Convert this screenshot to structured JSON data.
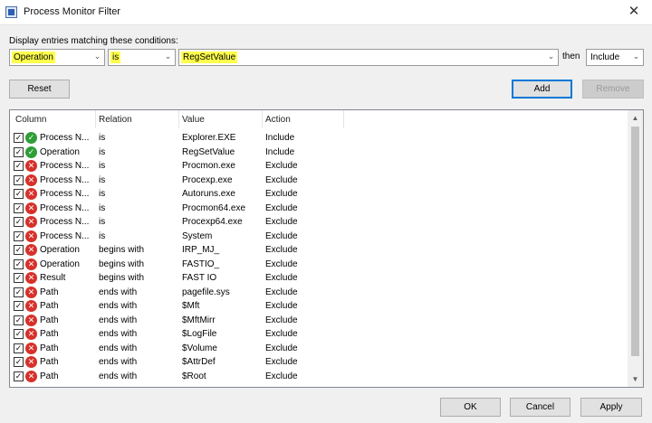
{
  "window": {
    "title": "Process Monitor Filter",
    "close_glyph": "✕"
  },
  "conditions": {
    "label": "Display entries matching these conditions:",
    "column_value": "Operation",
    "relation_value": "is",
    "value_value": "RegSetValue",
    "then_label": "then",
    "action_value": "Include"
  },
  "buttons": {
    "reset": "Reset",
    "add": "Add",
    "remove": "Remove",
    "ok": "OK",
    "cancel": "Cancel",
    "apply": "Apply"
  },
  "list": {
    "headers": {
      "column": "Column",
      "relation": "Relation",
      "value": "Value",
      "action": "Action"
    },
    "rows": [
      {
        "column": "Process N...",
        "relation": "is",
        "value": "Explorer.EXE",
        "action": "Include",
        "status": "include"
      },
      {
        "column": "Operation",
        "relation": "is",
        "value": "RegSetValue",
        "action": "Include",
        "status": "include"
      },
      {
        "column": "Process N...",
        "relation": "is",
        "value": "Procmon.exe",
        "action": "Exclude",
        "status": "exclude"
      },
      {
        "column": "Process N...",
        "relation": "is",
        "value": "Procexp.exe",
        "action": "Exclude",
        "status": "exclude"
      },
      {
        "column": "Process N...",
        "relation": "is",
        "value": "Autoruns.exe",
        "action": "Exclude",
        "status": "exclude"
      },
      {
        "column": "Process N...",
        "relation": "is",
        "value": "Procmon64.exe",
        "action": "Exclude",
        "status": "exclude"
      },
      {
        "column": "Process N...",
        "relation": "is",
        "value": "Procexp64.exe",
        "action": "Exclude",
        "status": "exclude"
      },
      {
        "column": "Process N...",
        "relation": "is",
        "value": "System",
        "action": "Exclude",
        "status": "exclude"
      },
      {
        "column": "Operation",
        "relation": "begins with",
        "value": "IRP_MJ_",
        "action": "Exclude",
        "status": "exclude"
      },
      {
        "column": "Operation",
        "relation": "begins with",
        "value": "FASTIO_",
        "action": "Exclude",
        "status": "exclude"
      },
      {
        "column": "Result",
        "relation": "begins with",
        "value": "FAST IO",
        "action": "Exclude",
        "status": "exclude"
      },
      {
        "column": "Path",
        "relation": "ends with",
        "value": "pagefile.sys",
        "action": "Exclude",
        "status": "exclude"
      },
      {
        "column": "Path",
        "relation": "ends with",
        "value": "$Mft",
        "action": "Exclude",
        "status": "exclude"
      },
      {
        "column": "Path",
        "relation": "ends with",
        "value": "$MftMirr",
        "action": "Exclude",
        "status": "exclude"
      },
      {
        "column": "Path",
        "relation": "ends with",
        "value": "$LogFile",
        "action": "Exclude",
        "status": "exclude"
      },
      {
        "column": "Path",
        "relation": "ends with",
        "value": "$Volume",
        "action": "Exclude",
        "status": "exclude"
      },
      {
        "column": "Path",
        "relation": "ends with",
        "value": "$AttrDef",
        "action": "Exclude",
        "status": "exclude"
      },
      {
        "column": "Path",
        "relation": "ends with",
        "value": "$Root",
        "action": "Exclude",
        "status": "exclude"
      }
    ]
  },
  "icons": {
    "checkbox": "✓",
    "include": "✓",
    "exclude": "✕",
    "dropdown": "⌄",
    "scroll_up": "▲",
    "scroll_down": "▼"
  },
  "colors": {
    "highlight": "#ffff4d",
    "include": "#2e9e37",
    "exclude": "#d6312a",
    "default_border": "#0078d7"
  }
}
